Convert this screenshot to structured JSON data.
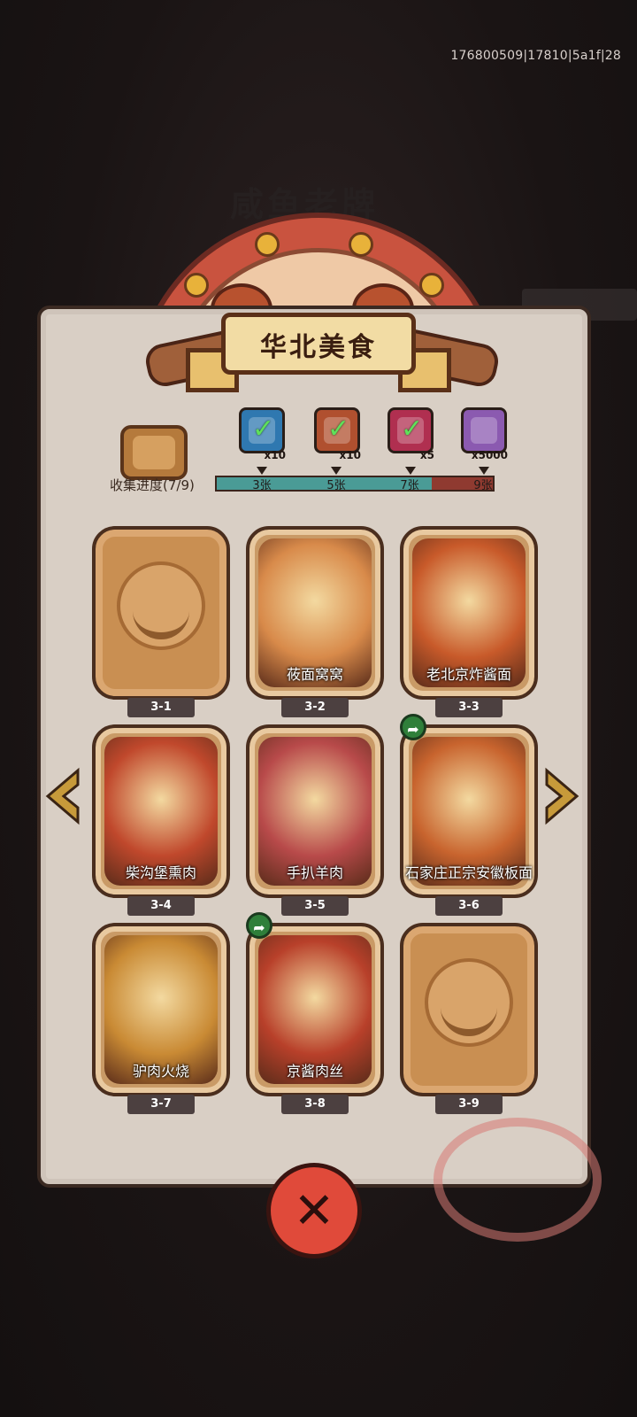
{
  "debug_info": "176800509|17810|5a1f|28",
  "background_title": "咸鱼老牌",
  "panel_title": "华北美食",
  "progress": {
    "label": "收集进度(7/9)",
    "collected": 7,
    "total": 9,
    "milestones": [
      {
        "label": "3张",
        "reward_qty": "x10",
        "reward_icon": "chest-icon",
        "claimed": true,
        "color": "#2f78b0"
      },
      {
        "label": "5张",
        "reward_qty": "x10",
        "reward_icon": "key-icon",
        "claimed": true,
        "color": "#b0502f"
      },
      {
        "label": "7张",
        "reward_qty": "x5",
        "reward_icon": "orb-icon",
        "claimed": true,
        "color": "#b02f50"
      },
      {
        "label": "9张",
        "reward_qty": "x5000",
        "reward_icon": "crystal-icon",
        "claimed": false,
        "color": "#8b5ab0"
      }
    ]
  },
  "cards": [
    {
      "id": "3-1",
      "name": "",
      "unlocked": false,
      "shared": false,
      "color": "#c98f52"
    },
    {
      "id": "3-2",
      "name": "莜面窝窝",
      "unlocked": true,
      "shared": false,
      "color": "#d88a4a"
    },
    {
      "id": "3-3",
      "name": "老北京炸酱面",
      "unlocked": true,
      "shared": false,
      "color": "#c85a2a"
    },
    {
      "id": "3-4",
      "name": "柴沟堡熏肉",
      "unlocked": true,
      "shared": false,
      "color": "#c0482c"
    },
    {
      "id": "3-5",
      "name": "手扒羊肉",
      "unlocked": true,
      "shared": false,
      "color": "#b84a4a"
    },
    {
      "id": "3-6",
      "name": "石家庄正宗安徽板面",
      "unlocked": true,
      "shared": true,
      "color": "#c8642e"
    },
    {
      "id": "3-7",
      "name": "驴肉火烧",
      "unlocked": true,
      "shared": false,
      "color": "#c98a34"
    },
    {
      "id": "3-8",
      "name": "京酱肉丝",
      "unlocked": true,
      "shared": true,
      "color": "#b8402a"
    },
    {
      "id": "3-9",
      "name": "",
      "unlocked": false,
      "shared": false,
      "color": "#c98f52"
    }
  ],
  "close_icon": "close-x-icon",
  "prev_icon": "arrow-left-icon",
  "next_icon": "arrow-right-icon"
}
